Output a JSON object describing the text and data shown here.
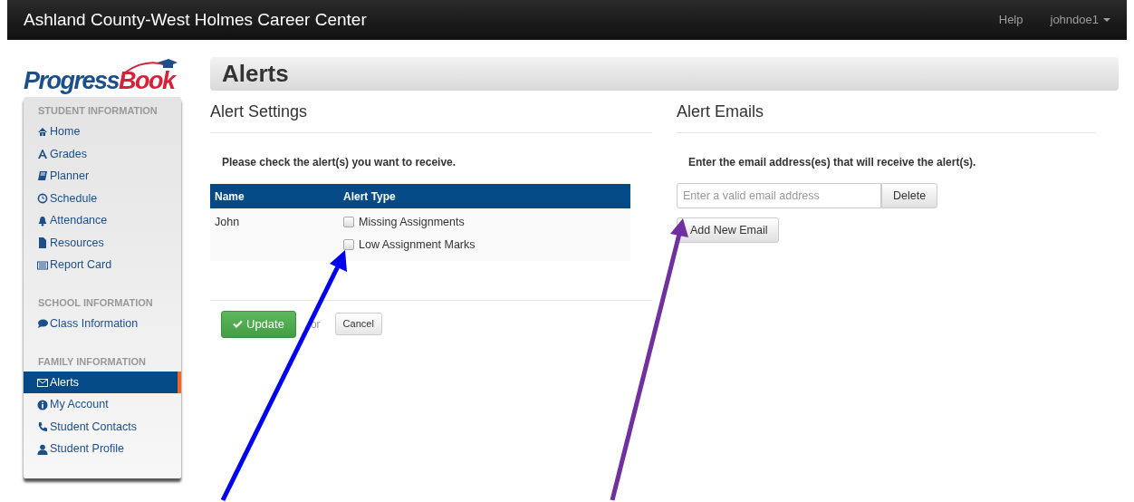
{
  "navbar": {
    "title": "Ashland County-West Holmes Career Center",
    "links": [
      "Help"
    ],
    "user": "johndoe1"
  },
  "logo": {
    "text_a": "Progress",
    "text_b": "Book"
  },
  "sidebar": {
    "sections": [
      {
        "heading": "STUDENT INFORMATION",
        "items": [
          {
            "label": "Home",
            "selected": false
          },
          {
            "label": "Grades",
            "selected": false
          },
          {
            "label": "Planner",
            "selected": false
          },
          {
            "label": "Schedule",
            "selected": false
          },
          {
            "label": "Attendance",
            "selected": false
          },
          {
            "label": "Resources",
            "selected": false
          },
          {
            "label": "Report Card",
            "selected": false
          }
        ]
      },
      {
        "heading": "SCHOOL INFORMATION",
        "items": [
          {
            "label": "Class Information",
            "selected": false
          }
        ]
      },
      {
        "heading": "FAMILY INFORMATION",
        "items": [
          {
            "label": "Alerts",
            "selected": true
          },
          {
            "label": "My Account",
            "selected": false
          },
          {
            "label": "Student Contacts",
            "selected": false
          },
          {
            "label": "Student Profile",
            "selected": false
          }
        ]
      }
    ]
  },
  "page_title": "Alerts",
  "settings": {
    "title": "Alert Settings",
    "instruction": "Please check the alert(s) you want to receive.",
    "columns": [
      "Name",
      "Alert Type"
    ],
    "rows": [
      {
        "name": "John",
        "alerts": [
          {
            "label": "Missing Assignments",
            "checked": false
          },
          {
            "label": "Low Assignment Marks",
            "checked": false
          }
        ]
      }
    ],
    "update_button": "Update",
    "separator": "or",
    "cancel_button": "Cancel"
  },
  "emails": {
    "title": "Alert Emails",
    "instruction": "Enter the email address(es) that will receive the alert(s).",
    "fields": [
      {
        "placeholder": "Enter a valid email address",
        "delete_button": "Delete"
      }
    ],
    "add_button": "Add New Email"
  }
}
